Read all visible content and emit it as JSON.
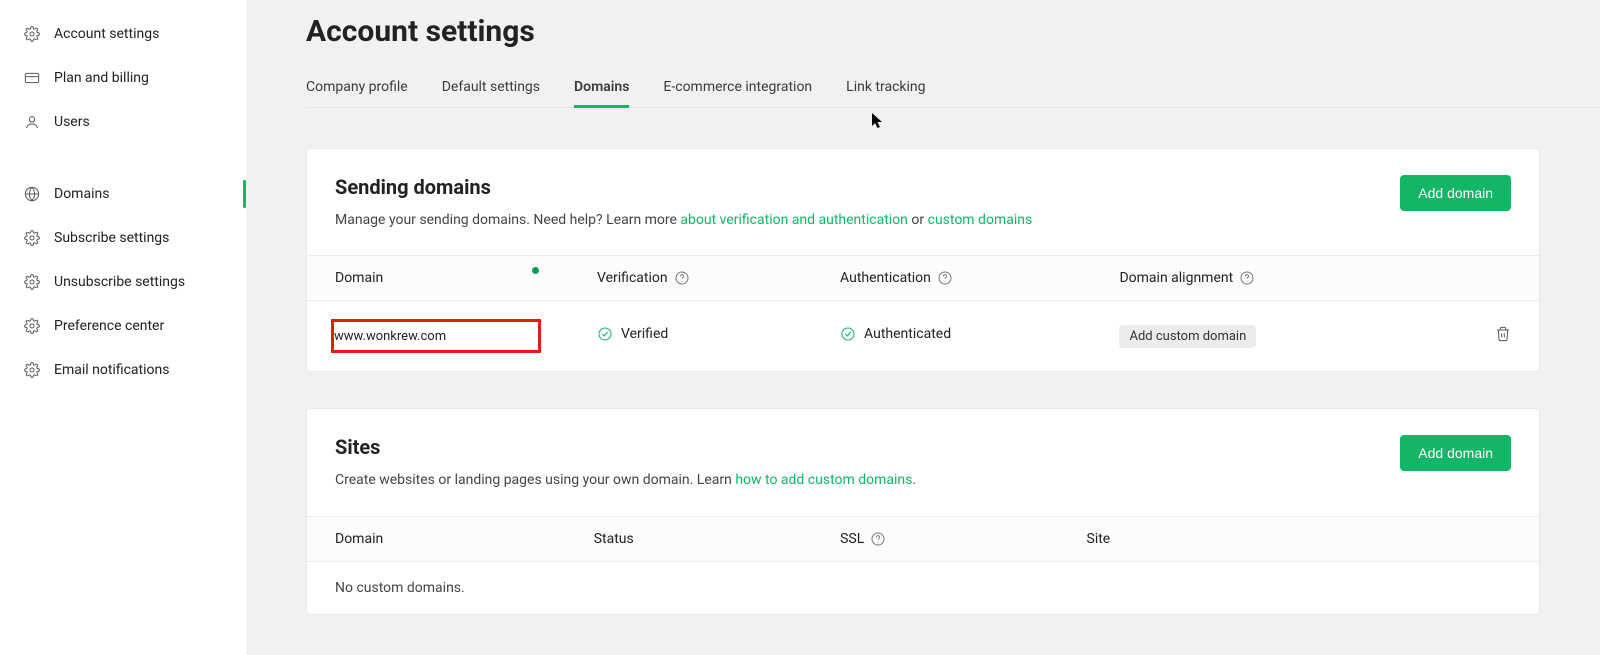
{
  "sidebar": {
    "items": [
      {
        "label": "Account settings",
        "icon": "gear-icon"
      },
      {
        "label": "Plan and billing",
        "icon": "card-icon"
      },
      {
        "label": "Users",
        "icon": "user-icon"
      },
      {
        "label": "Domains",
        "icon": "globe-icon",
        "active": true
      },
      {
        "label": "Subscribe settings",
        "icon": "gear-icon"
      },
      {
        "label": "Unsubscribe settings",
        "icon": "gear-icon"
      },
      {
        "label": "Preference center",
        "icon": "gear-icon"
      },
      {
        "label": "Email notifications",
        "icon": "gear-icon"
      }
    ]
  },
  "header": {
    "title": "Account settings"
  },
  "tabs": [
    {
      "label": "Company profile"
    },
    {
      "label": "Default settings"
    },
    {
      "label": "Domains",
      "active": true
    },
    {
      "label": "E-commerce integration"
    },
    {
      "label": "Link tracking"
    }
  ],
  "sending": {
    "title": "Sending domains",
    "desc_pre": "Manage your sending domains. Need help? Learn more ",
    "link1": "about verification and authentication",
    "mid": " or ",
    "link2": "custom domains",
    "add_button": "Add domain",
    "columns": {
      "domain": "Domain",
      "verification": "Verification",
      "authentication": "Authentication",
      "alignment": "Domain alignment"
    },
    "row": {
      "domain": "www.wonkrew.com",
      "verification": "Verified",
      "authentication": "Authenticated",
      "alignment_chip": "Add custom domain"
    }
  },
  "sites": {
    "title": "Sites",
    "desc_pre": "Create websites or landing pages using your own domain. Learn ",
    "link": "how to add custom domains",
    "desc_post": ".",
    "add_button": "Add domain",
    "columns": {
      "domain": "Domain",
      "status": "Status",
      "ssl": "SSL",
      "site": "Site"
    },
    "empty": "No custom domains."
  }
}
